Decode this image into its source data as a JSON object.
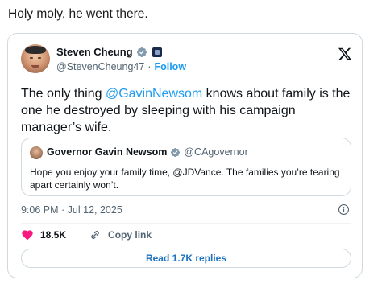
{
  "intro_text": "Holy moly, he went there.",
  "tweet": {
    "author_name": "Steven Cheung",
    "author_handle": "@StevenCheung47",
    "separator": "·",
    "follow_label": "Follow",
    "text_before": "The only thing ",
    "mention": "@GavinNewsom",
    "text_after": " knows about family is the one he destroyed by sleeping with his campaign manager’s wife.",
    "timestamp": "9:06 PM · Jul 12, 2025",
    "likes": "18.5K",
    "copy_link_label": "Copy link",
    "read_replies_label": "Read 1.7K replies"
  },
  "quoted": {
    "author_name": "Governor Gavin Newsom",
    "author_handle": "@CAgovernor",
    "text": "Hope you enjoy your family time, @JDVance. The families you’re tearing apart certainly won’t."
  },
  "colors": {
    "accent": "#1d9bf0",
    "like": "#f91880",
    "muted": "#536471",
    "border": "#cfd9de"
  },
  "icons": {
    "verified": "verified-badge-icon",
    "affiliation": "affiliation-badge-icon",
    "platform": "x-logo-icon",
    "info": "info-icon",
    "like": "heart-icon",
    "copy_link": "link-icon"
  }
}
